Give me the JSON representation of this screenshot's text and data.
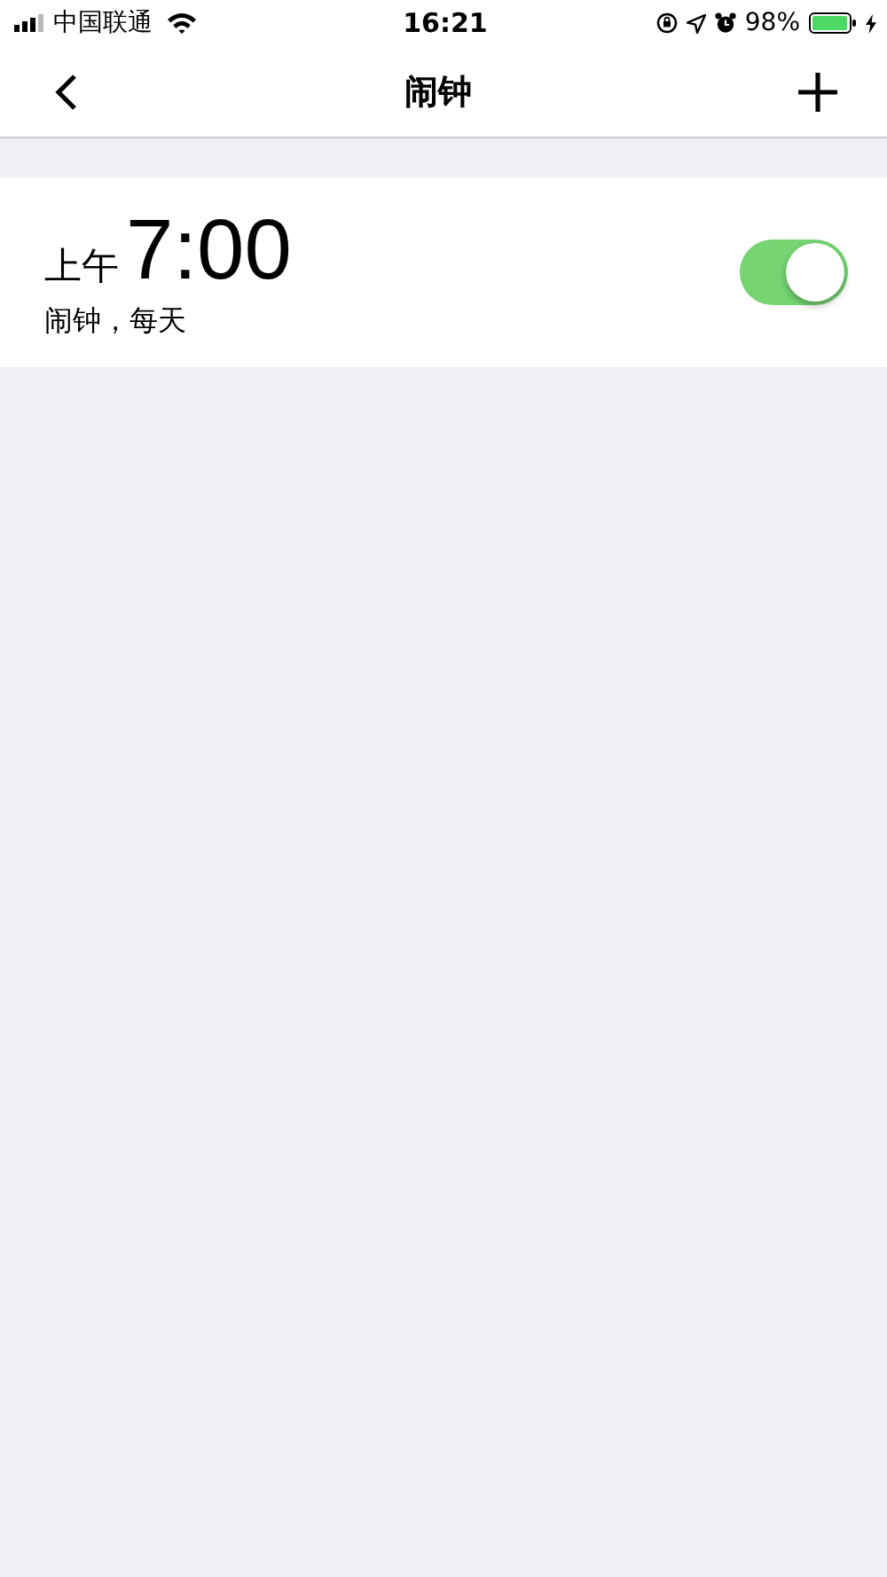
{
  "status_bar": {
    "carrier": "中国联通",
    "time": "16:21",
    "battery": "98%"
  },
  "nav": {
    "title": "闹钟"
  },
  "alarms": [
    {
      "period": "上午",
      "time": "7:00",
      "label": "闹钟，每天",
      "on": true
    }
  ]
}
